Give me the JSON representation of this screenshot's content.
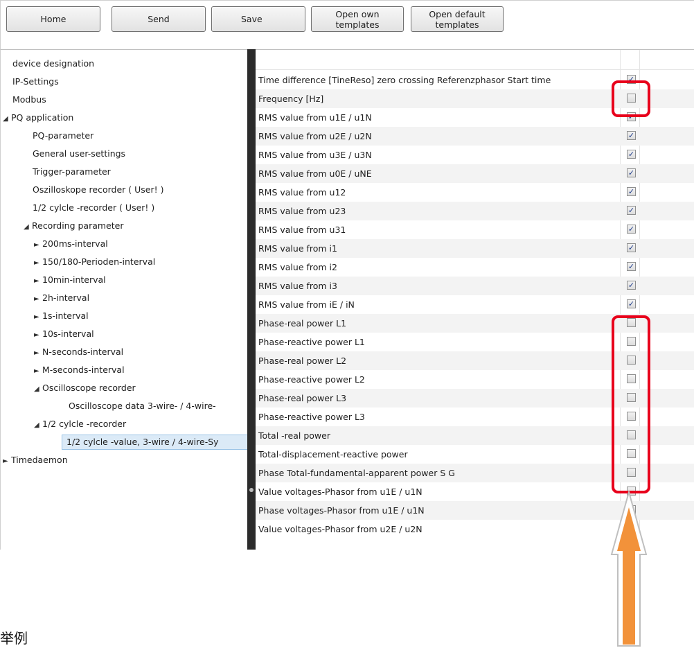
{
  "toolbar": {
    "home": "Home",
    "send": "Send",
    "save": "Save",
    "open_own": "Open own\ntemplates",
    "open_default": "Open default\ntemplates"
  },
  "tree": [
    {
      "label": "device designation",
      "toggle": "",
      "level": 0
    },
    {
      "label": "IP-Settings",
      "toggle": "",
      "level": 0
    },
    {
      "label": "Modbus",
      "toggle": "",
      "level": 0
    },
    {
      "label": "PQ application",
      "toggle": "◢",
      "level": -1
    },
    {
      "label": "PQ-parameter",
      "toggle": "",
      "level": 1
    },
    {
      "label": "General user-settings",
      "toggle": "",
      "level": 1
    },
    {
      "label": "Trigger-parameter",
      "toggle": "",
      "level": 1
    },
    {
      "label": "Oszilloskope recorder ( User! )",
      "toggle": "",
      "level": 1
    },
    {
      "label": "1/2 cylcle -recorder ( User! )",
      "toggle": "",
      "level": 1
    },
    {
      "label": "Recording parameter",
      "toggle": "◢",
      "level": 2
    },
    {
      "label": "200ms-interval",
      "toggle": "►",
      "level": 3
    },
    {
      "label": "150/180-Perioden-interval",
      "toggle": "►",
      "level": 3
    },
    {
      "label": "10min-interval",
      "toggle": "►",
      "level": 3
    },
    {
      "label": "2h-interval",
      "toggle": "►",
      "level": 3
    },
    {
      "label": "1s-interval",
      "toggle": "►",
      "level": 3
    },
    {
      "label": "10s-interval",
      "toggle": "►",
      "level": 3
    },
    {
      "label": "N-seconds-interval",
      "toggle": "►",
      "level": 3
    },
    {
      "label": "M-seconds-interval",
      "toggle": "►",
      "level": 3
    },
    {
      "label": "Oscilloscope recorder",
      "toggle": "◢",
      "level": 3
    },
    {
      "label": "Oscilloscope data 3-wire- / 4-wire-",
      "toggle": "",
      "level": 5
    },
    {
      "label": "1/2 cylcle -recorder",
      "toggle": "◢",
      "level": 3
    },
    {
      "label": "1/2 cylcle -value, 3-wire / 4-wire-Sy",
      "toggle": "",
      "level": 5,
      "selected": true
    },
    {
      "label": "Timedaemon",
      "toggle": "►",
      "level": -2
    }
  ],
  "grid": {
    "rows": [
      {
        "label": "Time difference [TineReso] zero crossing Referenzphasor Start time",
        "checked": true
      },
      {
        "label": "Frequency [Hz]",
        "checked": false
      },
      {
        "label": "RMS value from u1E / u1N",
        "checked": true
      },
      {
        "label": "RMS value from u2E / u2N",
        "checked": true
      },
      {
        "label": "RMS value from u3E / u3N",
        "checked": true
      },
      {
        "label": "RMS value from u0E / uNE",
        "checked": true
      },
      {
        "label": "RMS value from u12",
        "checked": true
      },
      {
        "label": "RMS value from u23",
        "checked": true
      },
      {
        "label": "RMS value from u31",
        "checked": true
      },
      {
        "label": "RMS value from i1",
        "checked": true
      },
      {
        "label": "RMS value from i2",
        "checked": true
      },
      {
        "label": "RMS value from i3",
        "checked": true
      },
      {
        "label": "RMS value from iE / iN",
        "checked": true
      },
      {
        "label": "Phase-real power L1",
        "checked": false
      },
      {
        "label": "Phase-reactive power L1",
        "checked": false
      },
      {
        "label": "Phase-real power L2",
        "checked": false
      },
      {
        "label": "Phase-reactive power L2",
        "checked": false
      },
      {
        "label": "Phase-real power L3",
        "checked": false
      },
      {
        "label": "Phase-reactive power L3",
        "checked": false
      },
      {
        "label": "Total -real power",
        "checked": false
      },
      {
        "label": "Total-displacement-reactive power",
        "checked": false
      },
      {
        "label": "Phase Total-fundamental-apparent power S G",
        "checked": false
      },
      {
        "label": "Value voltages-Phasor from u1E / u1N",
        "checked": false
      },
      {
        "label": "Phase voltages-Phasor from u1E / u1N",
        "checked": false
      },
      {
        "label": "Value voltages-Phasor from u2E / u2N",
        "checked": false
      }
    ]
  },
  "annotation": {
    "highlight_color": "#e8001c",
    "arrow_color": "#f2923a"
  },
  "caption": "举例"
}
